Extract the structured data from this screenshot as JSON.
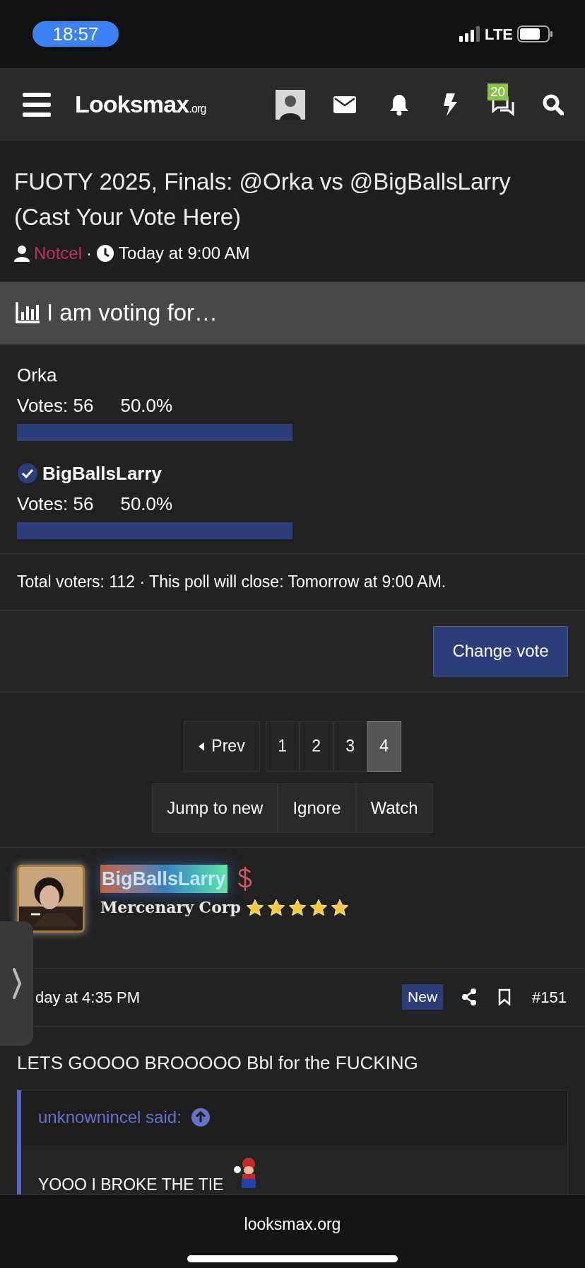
{
  "status_bar": {
    "time": "18:57",
    "network": "LTE"
  },
  "nav": {
    "logo": "Looksmax",
    "logo_suffix": ".org",
    "alerts_badge": "20"
  },
  "thread": {
    "title": "FUOTY 2025, Finals: @Orka vs @BigBallsLarry (Cast Your Vote Here)",
    "author": "Notcel",
    "separator": "·",
    "date": "Today at 9:00 AM"
  },
  "poll": {
    "heading": "I am voting for…",
    "options": [
      {
        "label": "Orka",
        "voted": false,
        "votes": "Votes: 56",
        "percent": "50.0%"
      },
      {
        "label": "BigBallsLarry",
        "voted": true,
        "votes": "Votes: 56",
        "percent": "50.0%"
      }
    ],
    "summary": "Total voters: 112 · This poll will close: Tomorrow at 9:00 AM.",
    "button": "Change vote"
  },
  "pagination": {
    "prev": "Prev",
    "pages": [
      {
        "label": "1",
        "selected": false
      },
      {
        "label": "2",
        "selected": false
      },
      {
        "label": "3",
        "selected": false
      },
      {
        "label": "4",
        "selected": true
      }
    ]
  },
  "actions": [
    "Jump to new",
    "Ignore",
    "Watch"
  ],
  "post": {
    "author": "BigBallsLarry",
    "rank": "Mercenary Corp",
    "stars": 5,
    "date": "day at 4:35 PM",
    "badge": "New",
    "number": "#151",
    "body": "LETS GOOOO BROOOOO Bbl for the FUCKING",
    "quote": {
      "author": "unknownincel said:",
      "text": "YOOO I BROKE THE TIE"
    }
  },
  "browser": {
    "url": "looksmax.org"
  }
}
